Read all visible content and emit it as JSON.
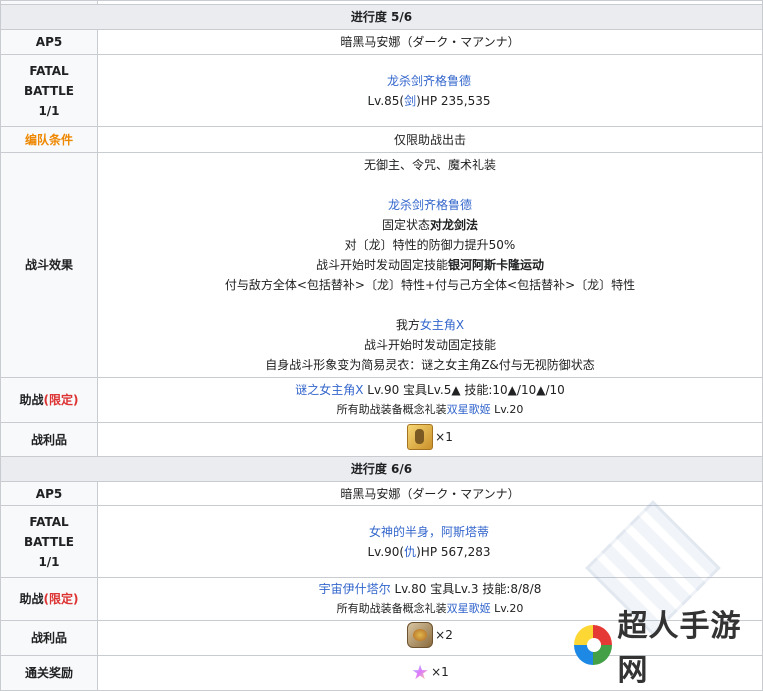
{
  "stage5": {
    "header": "进行度 5/6",
    "ap": {
      "label": "AP5",
      "value": "暗黑马安娜（ダーク・マアンナ）"
    },
    "fatal": {
      "label_lines": [
        "FATAL",
        "BATTLE",
        "1/1"
      ],
      "enemy_name": "龙杀剑齐格鲁德",
      "enemy_stats_prefix": "Lv.85(",
      "enemy_class": "剑",
      "enemy_stats_suffix": ")HP 235,535"
    },
    "formation": {
      "label": "编队条件",
      "value": "仅限助战出击"
    },
    "effects": {
      "label": "战斗效果",
      "line1": "无御主、令咒、魔术礼装",
      "enemy_name": "龙杀剑齐格鲁德",
      "fixed_prefix": "固定状态",
      "fixed_bold": "对龙剑法",
      "line3": "对〔龙〕特性的防御力提升50%",
      "skill_prefix": "战斗开始时发动固定技能",
      "skill_bold": "银河阿斯卡隆运动",
      "line5": "付与敌方全体<包括替补>〔龙〕特性+付与己方全体<包括替补>〔龙〕特性",
      "ally_prefix": "我方",
      "ally_name": "女主角X",
      "line7": "战斗开始时发动固定技能",
      "line8": "自身战斗形象变为简易灵衣：谜之女主角Z&付与无视防御状态"
    },
    "support": {
      "label": "助战",
      "label_tag": "(限定)",
      "servant": "谜之女主角X",
      "detail": " Lv.90 宝具Lv.5▲ 技能:10▲/10▲/10",
      "ce_prefix": "所有助战装备概念礼装",
      "ce_name": "双星歌姬",
      "ce_suffix": " Lv.20"
    },
    "loot": {
      "label": "战利品",
      "icon": "gold-statue-icon",
      "count": "×1"
    }
  },
  "stage6": {
    "header": "进行度 6/6",
    "ap": {
      "label": "AP5",
      "value": "暗黑马安娜（ダーク・マアンナ）"
    },
    "fatal": {
      "label_lines": [
        "FATAL",
        "BATTLE",
        "1/1"
      ],
      "enemy_name": "女神的半身，阿斯塔蒂",
      "enemy_stats_prefix": "Lv.90(",
      "enemy_class": "仇",
      "enemy_stats_suffix": ")HP 567,283"
    },
    "support": {
      "label": "助战",
      "label_tag": "(限定)",
      "servant": "宇宙伊什塔尔",
      "detail": " Lv.80 宝具Lv.3 技能:8/8/8",
      "ce_prefix": "所有助战装备概念礼装",
      "ce_name": "双星歌姬",
      "ce_suffix": " Lv.20"
    },
    "loot": {
      "label": "战利品",
      "icon": "dragon-egg-icon",
      "count": "×2"
    },
    "reward": {
      "label": "通关奖励",
      "icon": "rainbow-star-icon",
      "count": "×1"
    }
  },
  "watermark": {
    "text": "超人手游网"
  },
  "colors": {
    "link": "#3366cc",
    "orange": "#ee8800",
    "red": "#dd3333",
    "header_bg": "#eaecf0"
  }
}
